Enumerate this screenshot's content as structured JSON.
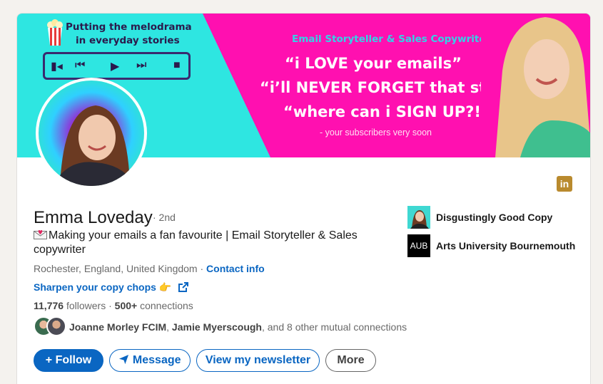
{
  "banner": {
    "tagline_line1": "Putting the melodrama",
    "tagline_line2": "in everyday stories",
    "subtitle": "Email Storyteller & Sales Copywriter",
    "quote1": "“i LOVE your emails”",
    "quote2": "“i’ll NEVER FORGET that story”",
    "quote3": "“where can i SIGN UP?!”",
    "signature": "- your subscribers very soon",
    "colors": {
      "cyan": "#2ee6e1",
      "pink": "#ff10b0",
      "navy": "#2b1a4c"
    }
  },
  "profile": {
    "name": "Emma Loveday",
    "degree": "· 2nd",
    "headline": "Making your emails a fan favourite | Email Storyteller & Sales copywriter",
    "location": "Rochester, England, United Kingdom",
    "separator": " · ",
    "contact_info": "Contact info",
    "link_text": "Sharpen your copy chops",
    "followers_count": "11,776",
    "followers_label": " followers",
    "connections_count": "500+",
    "connections_label": " connections",
    "mutual_name1": "Joanne Morley FCIM",
    "mutual_name2": "Jamie Myerscough",
    "mutual_rest": ", and 8 other mutual connections"
  },
  "orgs": [
    {
      "name": "Disgustingly Good Copy"
    },
    {
      "name": "Arts University Bournemouth",
      "logo_text": "AUB"
    }
  ],
  "actions": {
    "follow": "Follow",
    "message": "Message",
    "newsletter": "View my newsletter",
    "more": "More"
  },
  "linkedin_badge": "in",
  "accent_color": "#0a66c2"
}
